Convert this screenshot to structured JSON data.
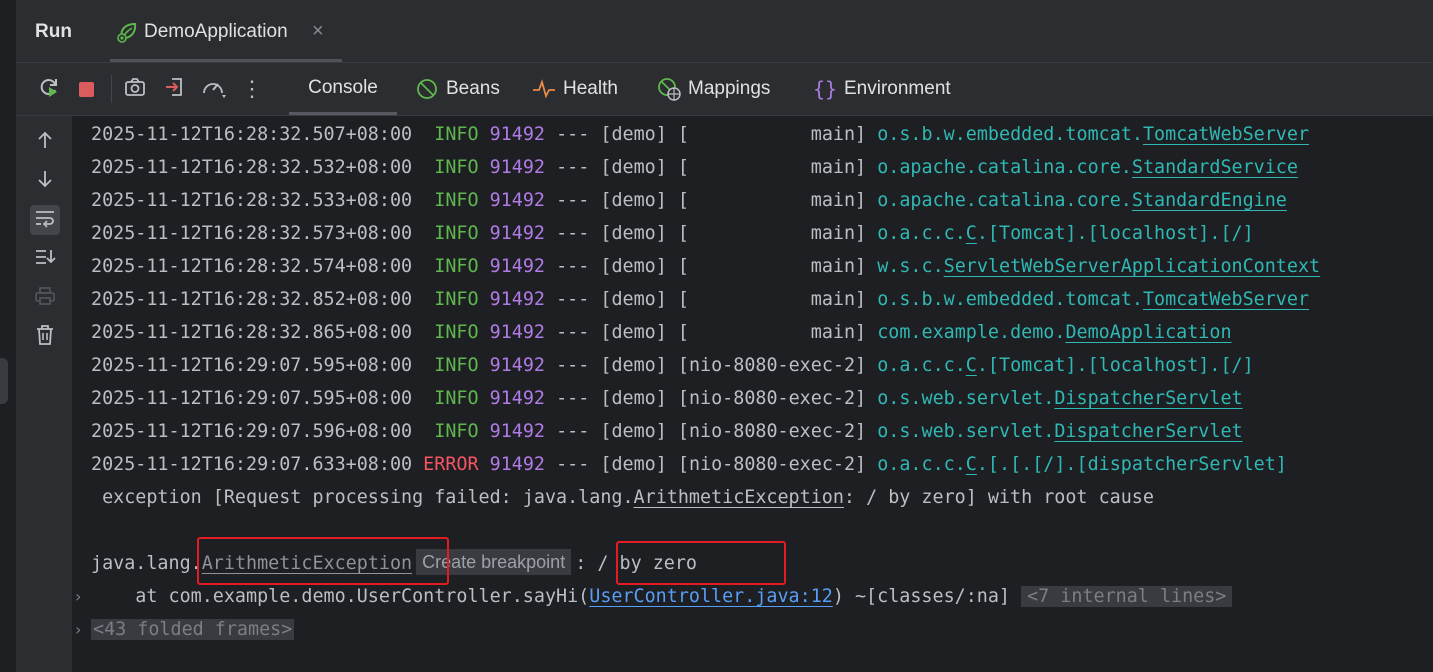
{
  "run_panel": {
    "title": "Run",
    "tab": {
      "label": "DemoApplication",
      "close": "×"
    }
  },
  "toolbar": {
    "tabs": [
      {
        "label": "Console",
        "icon": "console"
      },
      {
        "label": "Beans",
        "icon": "beans-icon"
      },
      {
        "label": "Health",
        "icon": "health-icon"
      },
      {
        "label": "Mappings",
        "icon": "mappings-icon"
      },
      {
        "label": "Environment",
        "icon": "environment-icon"
      }
    ],
    "more": "⋮"
  },
  "colors": {
    "info": "#5fb84d",
    "error": "#f75464",
    "pid": "#b07be6",
    "logger": "#2fb8b4",
    "link": "#589df6",
    "highlight_box": "#e31b23"
  },
  "logs": [
    {
      "ts": "2025-11-12T16:28:32.507+08:00",
      "level": " INFO",
      "pid": "91492",
      "sep": "---",
      "app": "[demo]",
      "thread": "[           main]",
      "pkg": "o.s.b.w.embedded.tomcat.",
      "cls": "TomcatWebServer",
      "rest": ""
    },
    {
      "ts": "2025-11-12T16:28:32.532+08:00",
      "level": " INFO",
      "pid": "91492",
      "sep": "---",
      "app": "[demo]",
      "thread": "[           main]",
      "pkg": "o.apache.catalina.core.",
      "cls": "StandardService",
      "rest": ""
    },
    {
      "ts": "2025-11-12T16:28:32.533+08:00",
      "level": " INFO",
      "pid": "91492",
      "sep": "---",
      "app": "[demo]",
      "thread": "[           main]",
      "pkg": "o.apache.catalina.core.",
      "cls": "StandardEngine",
      "rest": ""
    },
    {
      "ts": "2025-11-12T16:28:32.573+08:00",
      "level": " INFO",
      "pid": "91492",
      "sep": "---",
      "app": "[demo]",
      "thread": "[           main]",
      "pkg": "o.a.c.c.",
      "cls": "C",
      "rest": ".[Tomcat].[localhost].[/]"
    },
    {
      "ts": "2025-11-12T16:28:32.574+08:00",
      "level": " INFO",
      "pid": "91492",
      "sep": "---",
      "app": "[demo]",
      "thread": "[           main]",
      "pkg": "w.s.c.",
      "cls": "ServletWebServerApplicationContext",
      "rest": ""
    },
    {
      "ts": "2025-11-12T16:28:32.852+08:00",
      "level": " INFO",
      "pid": "91492",
      "sep": "---",
      "app": "[demo]",
      "thread": "[           main]",
      "pkg": "o.s.b.w.embedded.tomcat.",
      "cls": "TomcatWebServer",
      "rest": ""
    },
    {
      "ts": "2025-11-12T16:28:32.865+08:00",
      "level": " INFO",
      "pid": "91492",
      "sep": "---",
      "app": "[demo]",
      "thread": "[           main]",
      "pkg": "com.example.demo.",
      "cls": "DemoApplication",
      "rest": ""
    },
    {
      "ts": "2025-11-12T16:29:07.595+08:00",
      "level": " INFO",
      "pid": "91492",
      "sep": "---",
      "app": "[demo]",
      "thread": "[nio-8080-exec-2]",
      "pkg": "o.a.c.c.",
      "cls": "C",
      "rest": ".[Tomcat].[localhost].[/]"
    },
    {
      "ts": "2025-11-12T16:29:07.595+08:00",
      "level": " INFO",
      "pid": "91492",
      "sep": "---",
      "app": "[demo]",
      "thread": "[nio-8080-exec-2]",
      "pkg": "o.s.web.servlet.",
      "cls": "DispatcherServlet",
      "rest": ""
    },
    {
      "ts": "2025-11-12T16:29:07.596+08:00",
      "level": " INFO",
      "pid": "91492",
      "sep": "---",
      "app": "[demo]",
      "thread": "[nio-8080-exec-2]",
      "pkg": "o.s.web.servlet.",
      "cls": "DispatcherServlet",
      "rest": ""
    },
    {
      "ts": "2025-11-12T16:29:07.633+08:00",
      "level": "ERROR",
      "pid": "91492",
      "sep": "---",
      "app": "[demo]",
      "thread": "[nio-8080-exec-2]",
      "pkg": "o.a.c.c.",
      "cls": "C",
      "rest": ".[.[.[/].[dispatcherServlet]"
    }
  ],
  "exception_line": {
    "prefix": " exception [Request processing failed: java.lang.",
    "cls": "ArithmeticException",
    "suffix": ": / by zero] with root cause"
  },
  "trace": {
    "pkg": "java.lang.",
    "cls": "ArithmeticException",
    "popup": "Create breakpoint",
    "message": ": / by zero",
    "at_prefix": "    at com.example.demo.UserController.sayHi(",
    "at_link": "UserController.java:12",
    "at_suffix": ") ~[classes/:na]",
    "internal_lines": "<7 internal lines>",
    "folded_frames": "<43 folded frames>",
    "fold_arrow": "›"
  }
}
